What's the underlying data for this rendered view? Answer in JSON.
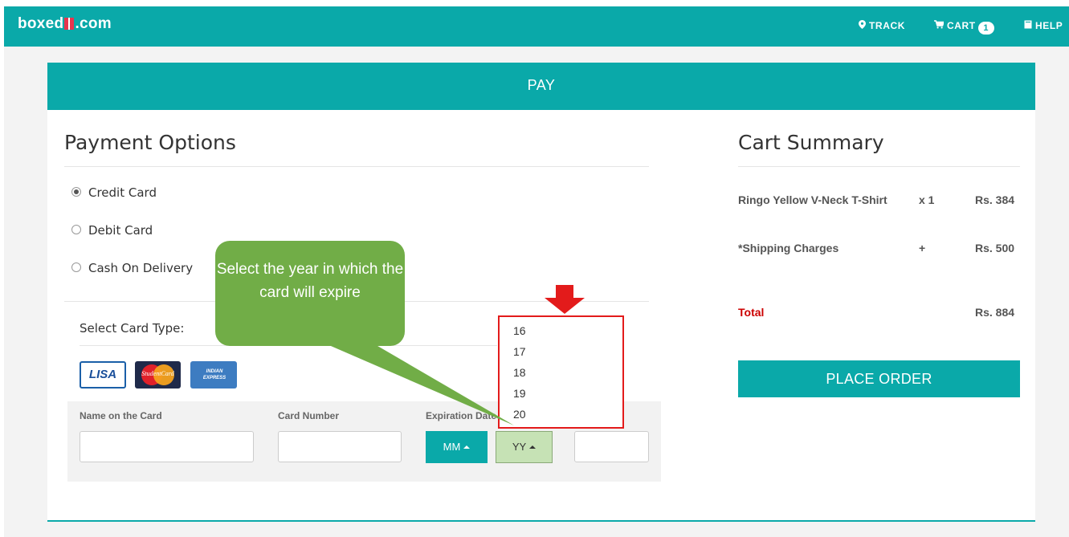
{
  "header": {
    "logo_prefix": "boxed",
    "logo_suffix": ".com",
    "nav": {
      "track": "TRACK",
      "cart": "CART",
      "cart_count": "1",
      "help": "HELP"
    }
  },
  "pay_banner": "PAY",
  "payment": {
    "title": "Payment Options",
    "options": [
      "Credit Card",
      "Debit Card",
      "Cash On Delivery"
    ],
    "selected": "Credit Card",
    "card_type_label": "Select Card Type:",
    "card_logos": [
      "LISA",
      "StudentCard",
      "INDIAN EXPRESS"
    ],
    "fields": {
      "name_label": "Name on the Card",
      "number_label": "Card Number",
      "expiry_label": "Expiration Date",
      "month_button": "MM",
      "year_button": "YY"
    },
    "year_options": [
      "16",
      "17",
      "18",
      "19",
      "20"
    ]
  },
  "callout_text": "Select the year in which the card will expire",
  "summary": {
    "title": "Cart Summary",
    "rows": [
      {
        "item": "Ringo Yellow V-Neck T-Shirt",
        "qty": "x 1",
        "price": "Rs. 384"
      },
      {
        "item": "*Shipping Charges",
        "qty": "+",
        "price": "Rs. 500"
      }
    ],
    "total_label": "Total",
    "total_value": "Rs. 884",
    "place_order": "PLACE ORDER"
  },
  "colors": {
    "teal": "#0aa9a9",
    "callout_green": "#71ad47",
    "highlight_red": "#e31b1b",
    "total_red": "#cc0000"
  }
}
